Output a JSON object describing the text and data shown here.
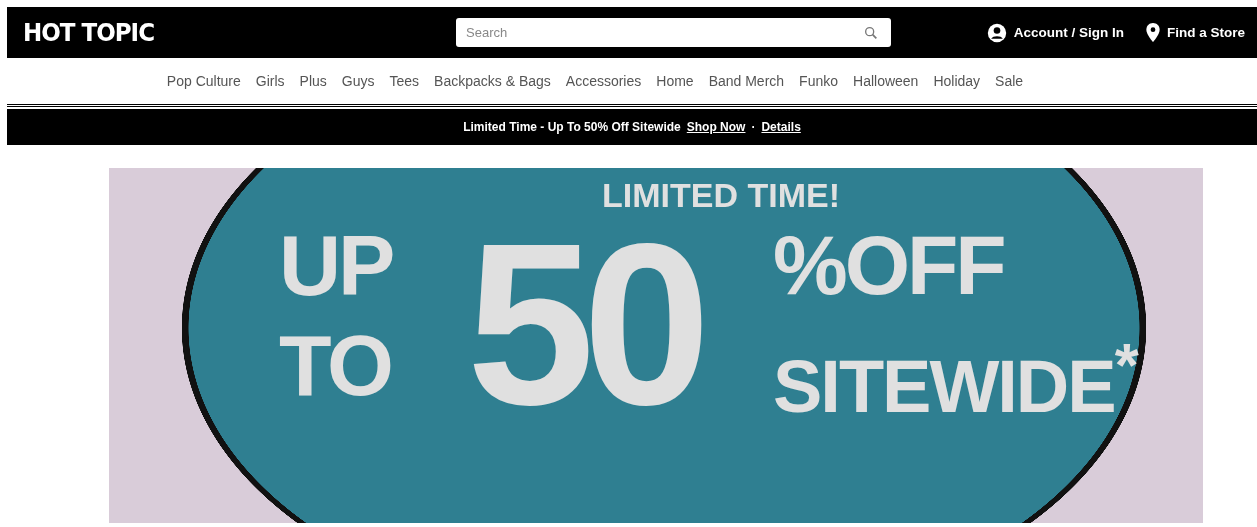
{
  "header": {
    "logo": "HOT TOPIC",
    "search": {
      "placeholder": "Search"
    },
    "account": "Account / Sign In",
    "store": "Find a Store"
  },
  "nav": {
    "items": [
      "Pop Culture",
      "Girls",
      "Plus",
      "Guys",
      "Tees",
      "Backpacks & Bags",
      "Accessories",
      "Home",
      "Band Merch",
      "Funko",
      "Halloween",
      "Holiday",
      "Sale"
    ]
  },
  "promo_bar": {
    "text": "Limited Time - Up To 50% Off Sitewide",
    "links": [
      "Shop Now",
      "Details"
    ],
    "separator": "·"
  },
  "hero": {
    "headline": "LIMITED TIME!",
    "up": "UP",
    "to": "TO",
    "amount": "50",
    "percent": "%",
    "off": "OFF",
    "scope": "SITEWIDE$^{*}$"
  }
}
